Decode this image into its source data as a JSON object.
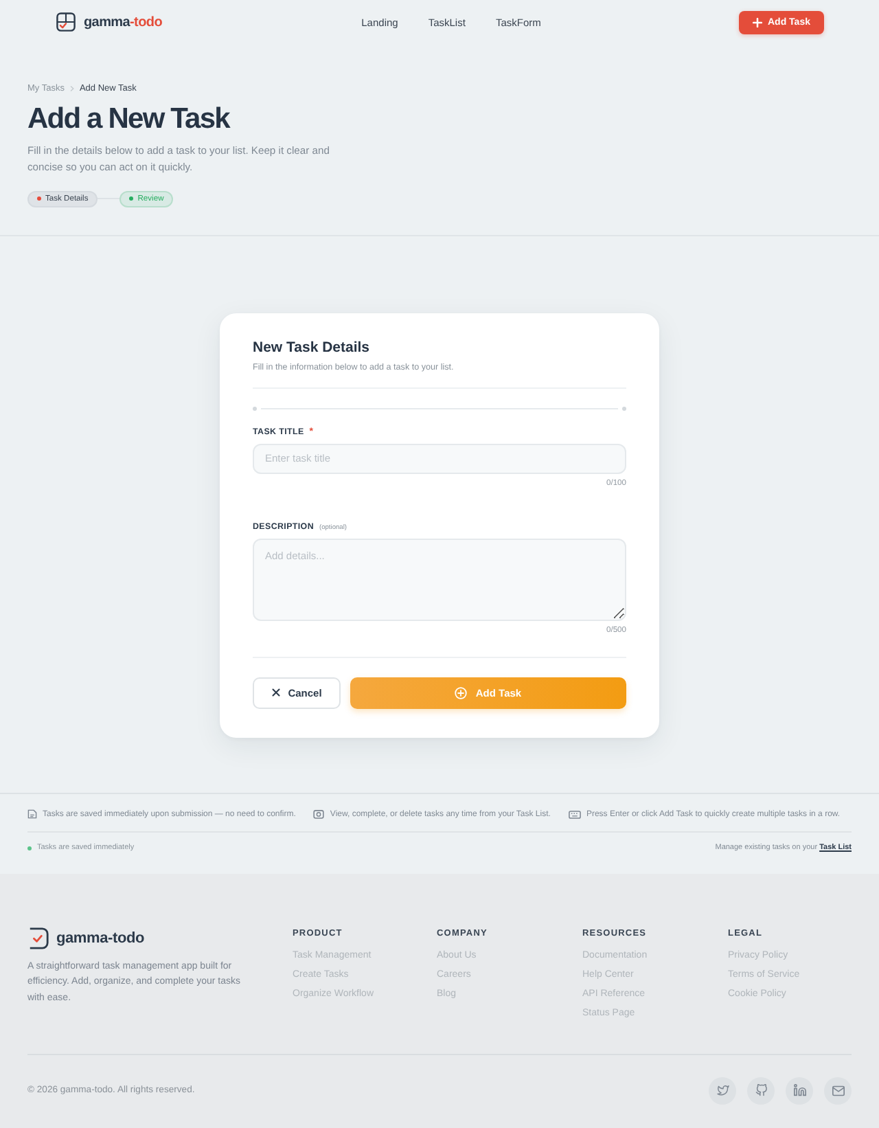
{
  "header": {
    "brand": {
      "name": "gamma",
      "accent": "-todo"
    },
    "nav": [
      {
        "label": "Landing"
      },
      {
        "label": "TaskList"
      },
      {
        "label": "TaskForm"
      }
    ],
    "cta": {
      "label": "Add Task"
    }
  },
  "hero": {
    "breadcrumb": [
      {
        "label": "My Tasks",
        "current": false
      },
      {
        "label": "Add New Task",
        "current": true
      }
    ],
    "title": "Add a New Task",
    "description": "Fill in the details below to add a task to your list. Keep it clear and concise so you can act on it quickly.",
    "steps": [
      {
        "label": "Task Details",
        "selected": true,
        "color": "#e74c3c"
      },
      {
        "label": "Review",
        "selected": false,
        "color": "#27ae60"
      }
    ]
  },
  "form": {
    "title": "New Task Details",
    "subtitle": "Fill in the information below to add a task to your list.",
    "fields": [
      {
        "kind": "input",
        "label": "TASK TITLE",
        "required_mark": "*",
        "placeholder": "Enter task title",
        "counter": "0/100"
      },
      {
        "kind": "textarea",
        "label": "DESCRIPTION",
        "note": "(optional)",
        "placeholder": "Add details...",
        "counter": "0/500"
      }
    ],
    "buttons": [
      {
        "kind": "secondary",
        "label": "Cancel"
      },
      {
        "kind": "primary",
        "label": "Add Task"
      }
    ]
  },
  "info": {
    "tips": [
      {
        "kind": "save",
        "text": "Tasks are saved immediately upon submission — no need to confirm."
      },
      {
        "kind": "view",
        "text": "View, complete, or delete tasks any time from your Task List."
      },
      {
        "kind": "keyboard",
        "text": "Press Enter or click Add Task to quickly create multiple tasks in a row."
      }
    ],
    "status": "Tasks are saved immediately",
    "note": {
      "text": "Manage existing tasks on your",
      "link": "Task List"
    }
  },
  "footer": {
    "brand": {
      "name": "gamma-todo",
      "description": "A straightforward task management app built for efficiency. Add, organize, and complete your tasks with ease."
    },
    "columns": [
      {
        "heading": "PRODUCT",
        "links": [
          "Task Management",
          "Create Tasks",
          "Organize Workflow"
        ]
      },
      {
        "heading": "COMPANY",
        "links": [
          "About Us",
          "Careers",
          "Blog"
        ]
      },
      {
        "heading": "RESOURCES",
        "links": [
          "Documentation",
          "Help Center",
          "API Reference",
          "Status Page"
        ]
      },
      {
        "heading": "LEGAL",
        "links": [
          "Privacy Policy",
          "Terms of Service",
          "Cookie Policy"
        ]
      }
    ],
    "copyright": "© 2026 gamma-todo. All rights reserved.",
    "social": [
      {
        "kind": "twitter"
      },
      {
        "kind": "github"
      },
      {
        "kind": "linkedin"
      },
      {
        "kind": "email"
      }
    ]
  }
}
